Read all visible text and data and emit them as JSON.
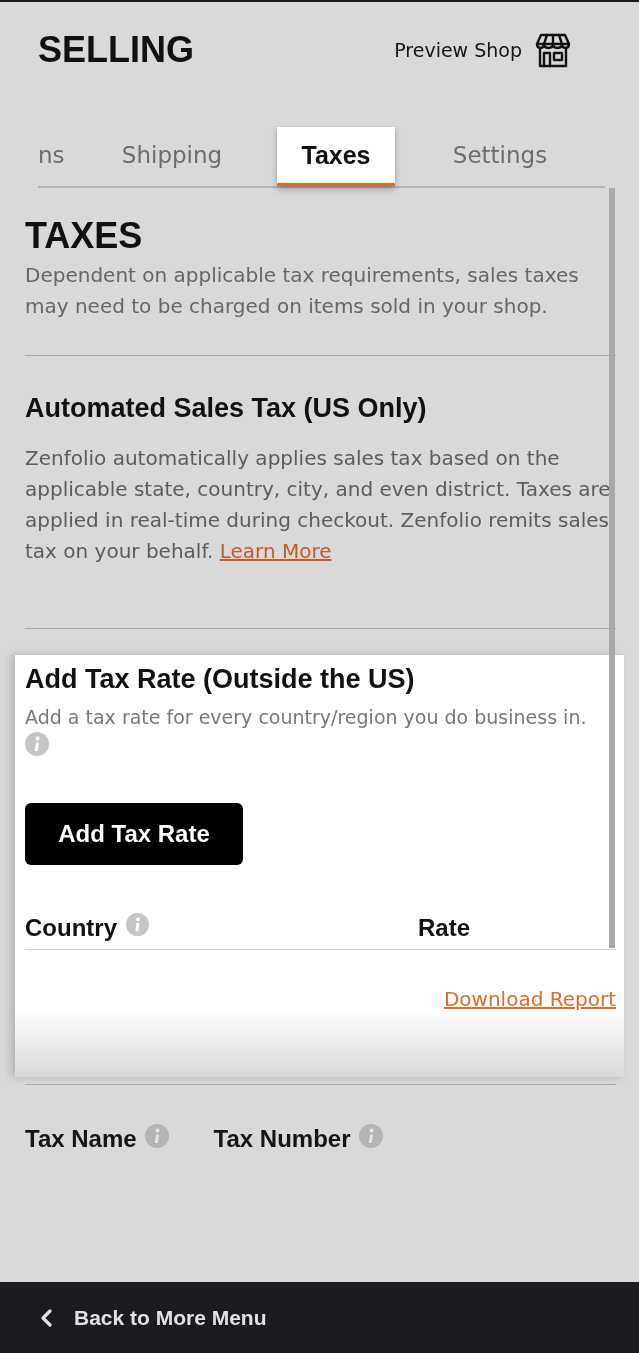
{
  "header": {
    "title": "SELLING",
    "preview_link": "Preview Shop"
  },
  "tabs": [
    {
      "label": "ns",
      "selected": false
    },
    {
      "label": "Shipping",
      "selected": false
    },
    {
      "label": "Taxes",
      "selected": true
    },
    {
      "label": "Settings",
      "selected": false
    }
  ],
  "taxes": {
    "title": "TAXES",
    "description": "Dependent on applicable tax requirements, sales taxes may need to be charged on items sold in your shop."
  },
  "automated": {
    "title": "Automated Sales Tax (US Only)",
    "description": "Zenfolio automatically applies sales tax based on the applicable state, country, city, and even district. Taxes are applied in real-time during checkout. Zenfolio remits sales tax on your behalf.",
    "link": "Learn More"
  },
  "add_tax_rate": {
    "title": "Add Tax Rate (Outside the US)",
    "description": "Add a tax rate for every country/region you do business in.",
    "button": "Add Tax Rate",
    "columns": [
      {
        "label": "Country",
        "info": true
      },
      {
        "label": "Rate",
        "info": false
      }
    ],
    "link": "Download Report"
  },
  "tax_fields": [
    {
      "label": "Tax Name",
      "info": true
    },
    {
      "label": "Tax Number",
      "info": true
    }
  ],
  "footer": {
    "back": "Back to More Menu"
  }
}
